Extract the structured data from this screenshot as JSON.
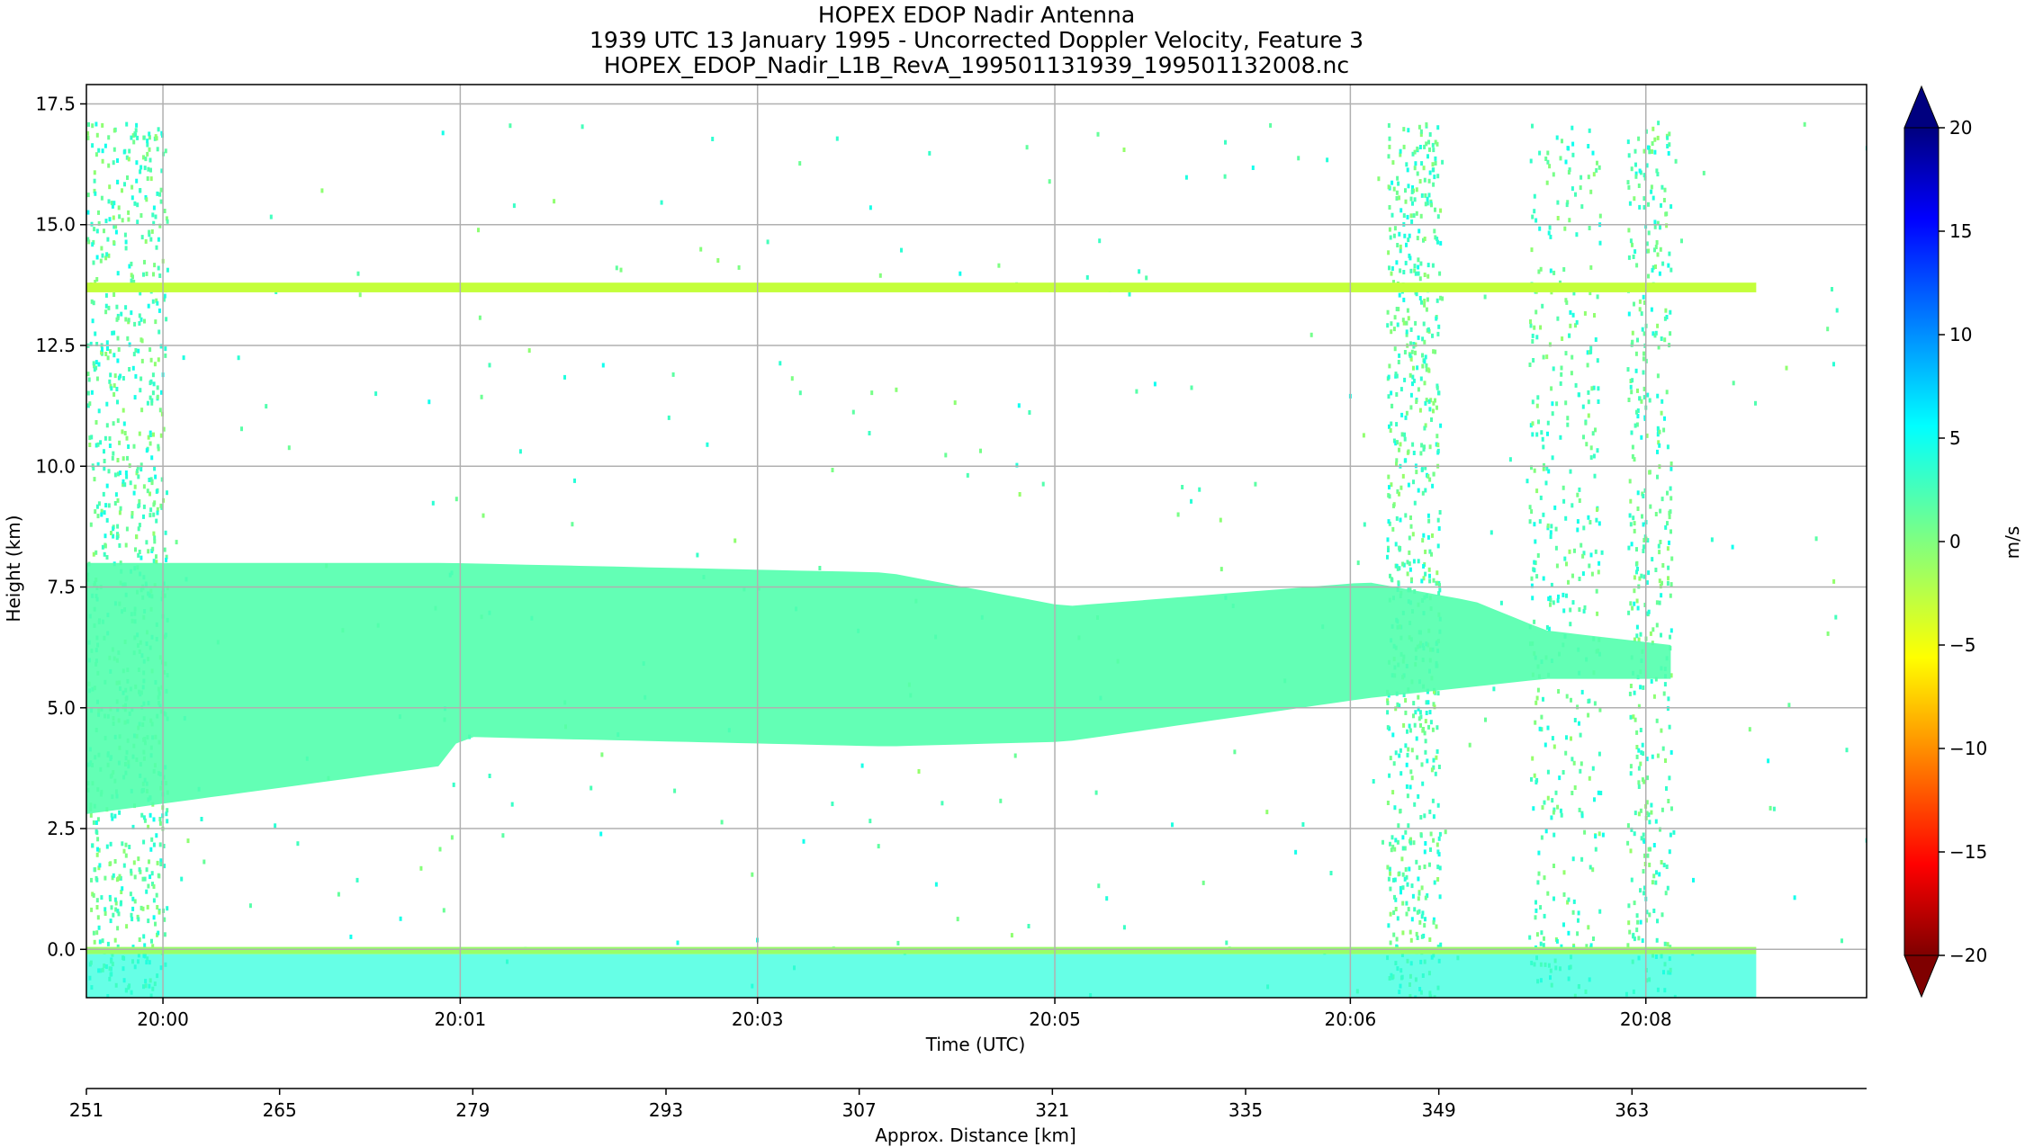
{
  "chart_data": {
    "type": "heatmap",
    "titles": [
      "HOPEX EDOP Nadir Antenna",
      "1939 UTC 13 January 1995 - Uncorrected Doppler Velocity, Feature 3",
      "HOPEX_EDOP_Nadir_L1B_RevA_199501131939_199501132008.nc"
    ],
    "xlabel": "Time (UTC)",
    "ylabel": "Height (km)",
    "x2label": "Approx. Distance [km]",
    "colorbar_label": "m/s",
    "grid": true,
    "ylim": [
      -1.0,
      17.9
    ],
    "yticks": [
      0.0,
      2.5,
      5.0,
      7.5,
      10.0,
      12.5,
      15.0,
      17.5
    ],
    "ytick_labels": [
      "0.0",
      "2.5",
      "5.0",
      "7.5",
      "10.0",
      "12.5",
      "15.0",
      "17.5"
    ],
    "xtick_labels": [
      "20:00",
      "20:01",
      "20:03",
      "20:05",
      "20:06",
      "20:08"
    ],
    "xtick_fracs": [
      0.043,
      0.21,
      0.377,
      0.544,
      0.71,
      0.876
    ],
    "distance_ticks": [
      251,
      265,
      279,
      293,
      307,
      321,
      335,
      349,
      363
    ],
    "distance_range": [
      251,
      380
    ],
    "colorbar": {
      "vmin": -20,
      "vmax": 20,
      "ticks": [
        20,
        15,
        10,
        5,
        0,
        -5,
        -10,
        -15,
        -20
      ],
      "tick_labels": [
        "20",
        "15",
        "10",
        "5",
        "0",
        "−5",
        "−10",
        "−15",
        "−20"
      ],
      "colormap": "jet_r",
      "colors": [
        "#7f0000",
        "#ff0000",
        "#ff8000",
        "#ffff00",
        "#80ff80",
        "#00ffff",
        "#0080ff",
        "#0000ff",
        "#00007f"
      ]
    },
    "features": [
      {
        "name": "echo-layer",
        "value_ms": 2,
        "time_frac": [
          0.0,
          0.89
        ],
        "base_km": [
          [
            0.0,
            2.8
          ],
          [
            0.2,
            3.8
          ],
          [
            0.21,
            4.4
          ],
          [
            0.45,
            4.2
          ],
          [
            0.55,
            4.3
          ],
          [
            0.72,
            5.2
          ],
          [
            0.82,
            5.6
          ],
          [
            0.89,
            5.6
          ]
        ],
        "top_km": [
          [
            0.0,
            8.0
          ],
          [
            0.2,
            8.0
          ],
          [
            0.45,
            7.8
          ],
          [
            0.55,
            7.1
          ],
          [
            0.72,
            7.6
          ],
          [
            0.78,
            7.2
          ],
          [
            0.82,
            6.6
          ],
          [
            0.89,
            6.3
          ]
        ]
      },
      {
        "name": "surface-return",
        "value_ms": -1,
        "time_frac": [
          0.0,
          0.938
        ],
        "height_km": [
          -0.1,
          0.05
        ]
      },
      {
        "name": "aircraft-level-line",
        "value_ms": -3,
        "time_frac": [
          0.0,
          0.938
        ],
        "height_km": [
          13.6,
          13.8
        ]
      }
    ]
  }
}
